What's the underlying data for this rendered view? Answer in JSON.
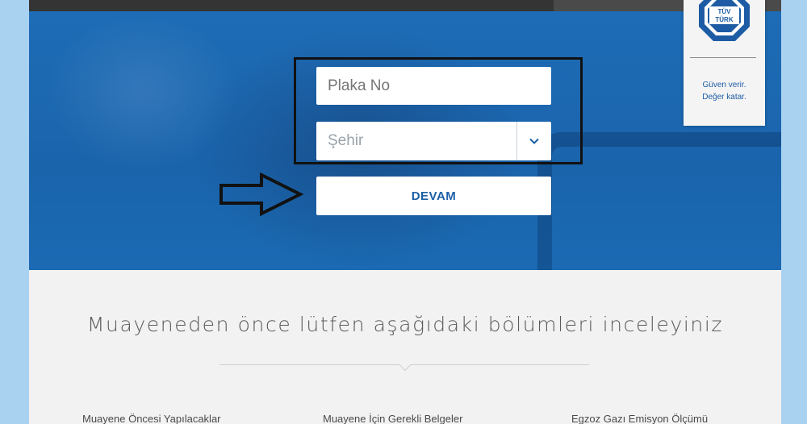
{
  "form": {
    "plate_placeholder": "Plaka No",
    "city_selected": "Şehir",
    "submit_label": "DEVAM"
  },
  "brand": {
    "logo_text_top": "TÜV",
    "logo_text_bottom": "TÜRK",
    "slogan_line1": "Güven verir.",
    "slogan_line2": "Değer katar."
  },
  "info": {
    "heading": "Muayeneden önce lütfen aşağıdaki bölümleri inceleyiniz",
    "sections": [
      {
        "label": "Muayene Öncesi Yapılacaklar"
      },
      {
        "label": "Muayene İçin Gerekli Belgeler"
      },
      {
        "label": "Egzoz Gazı Emisyon Ölçümü"
      }
    ]
  },
  "icons": {
    "dropdown": "chevron-down-icon",
    "annotation": "right-arrow-icon"
  },
  "colors": {
    "hero_blue": "#1e6cb6",
    "brand_blue": "#1c5fa6",
    "page_background": "#a9d1f0"
  }
}
